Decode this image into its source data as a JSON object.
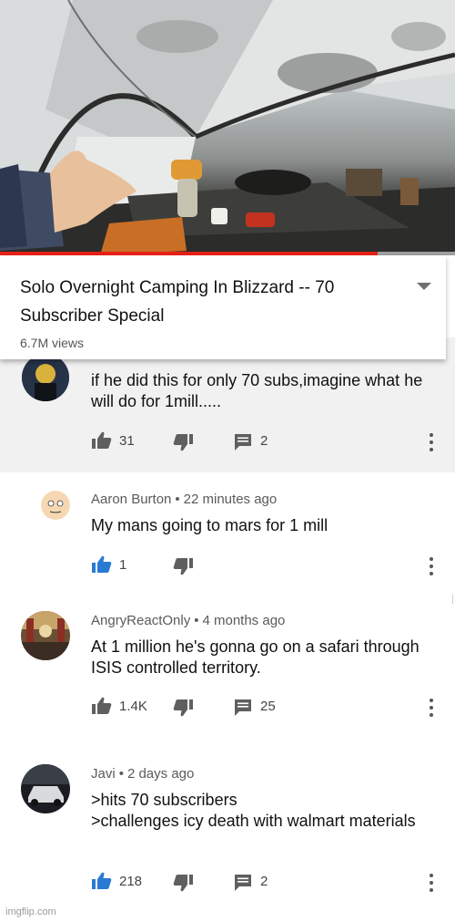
{
  "video": {
    "title": "Solo Overnight Camping In Blizzard -- 70 Subscriber Special",
    "views": "6.7M views",
    "progress": 0.83
  },
  "comments": [
    {
      "author": "",
      "time": "",
      "text": "if he did this for only 70 subs,imagine what he will do for 1mill.....",
      "likes": "31",
      "replies": "2",
      "liked": false,
      "highlighted": true
    },
    {
      "author": "Aaron Burton",
      "time": "22 minutes ago",
      "text": "My mans going to mars for 1 mill",
      "likes": "1",
      "replies": "",
      "liked": true
    },
    {
      "author": "AngryReactOnly",
      "time": "4 months ago",
      "text": "At 1 million he's gonna go on a safari through ISIS controlled territory.",
      "likes": "1.4K",
      "replies": "25",
      "liked": false
    },
    {
      "author": "Javi",
      "time": "2 days ago",
      "text": ">hits 70 subscribers\n>challenges icy death with walmart materials",
      "likes": "218",
      "replies": "2",
      "liked": true
    }
  ],
  "icons": [
    "thumbs-up-icon",
    "thumbs-down-icon",
    "reply-icon",
    "more-vert-icon",
    "chevron-down-icon"
  ],
  "colors": {
    "liked": "#2a7ad3",
    "progress": "#e62117"
  },
  "watermark": "imgflip.com"
}
